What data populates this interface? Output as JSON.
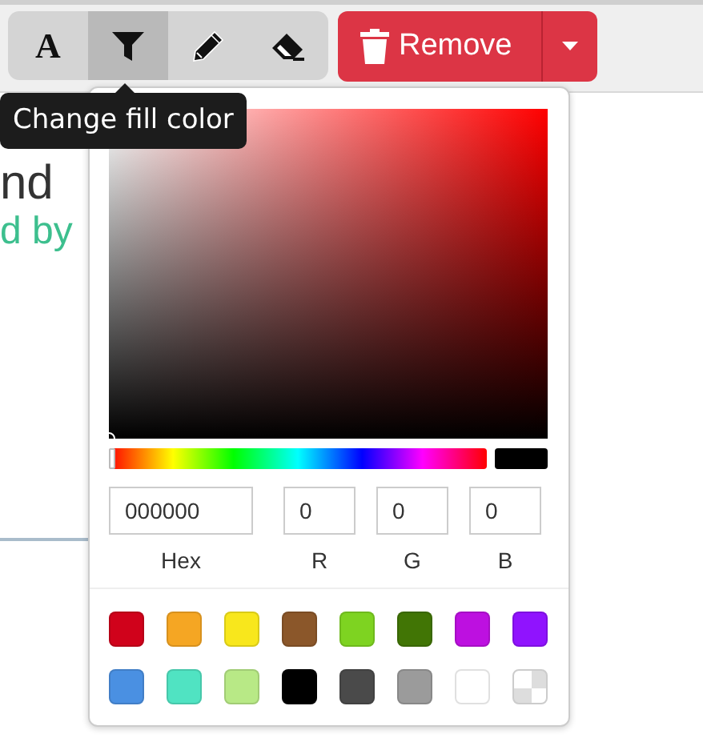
{
  "toolbar": {
    "tools": [
      {
        "kind": "text",
        "label": "A",
        "selected": false
      },
      {
        "kind": "fill",
        "selected": true
      },
      {
        "kind": "pencil",
        "selected": false
      },
      {
        "kind": "eraser",
        "selected": false
      }
    ],
    "remove_button": {
      "label": "Remove"
    }
  },
  "tooltip": {
    "text": "Change fill color"
  },
  "background": {
    "heading": "nd",
    "subtitle": "d by"
  },
  "color_picker": {
    "hue_slider": {
      "level": 0
    },
    "fields": [
      {
        "label": "Hex",
        "value": "000000"
      },
      {
        "label": "R",
        "value": "0"
      },
      {
        "label": "G",
        "value": "0"
      },
      {
        "label": "B",
        "value": "0"
      }
    ],
    "swatches": [
      {
        "kind": "solid",
        "color": "#d0021b"
      },
      {
        "kind": "solid",
        "color": "#f5a623"
      },
      {
        "kind": "solid",
        "color": "#f8e71c"
      },
      {
        "kind": "solid",
        "color": "#8b572a"
      },
      {
        "kind": "solid",
        "color": "#7ed321"
      },
      {
        "kind": "solid",
        "color": "#417505"
      },
      {
        "kind": "solid",
        "color": "#bd10e0"
      },
      {
        "kind": "solid",
        "color": "#9013fe"
      },
      {
        "kind": "solid",
        "color": "#4a90e2"
      },
      {
        "kind": "solid",
        "color": "#50e3c2"
      },
      {
        "kind": "solid",
        "color": "#b8e986"
      },
      {
        "kind": "solid",
        "color": "#000000"
      },
      {
        "kind": "solid",
        "color": "#4a4a4a"
      },
      {
        "kind": "solid",
        "color": "#9b9b9b"
      },
      {
        "kind": "solid",
        "color": "#ffffff"
      },
      {
        "kind": "transparent"
      }
    ]
  }
}
